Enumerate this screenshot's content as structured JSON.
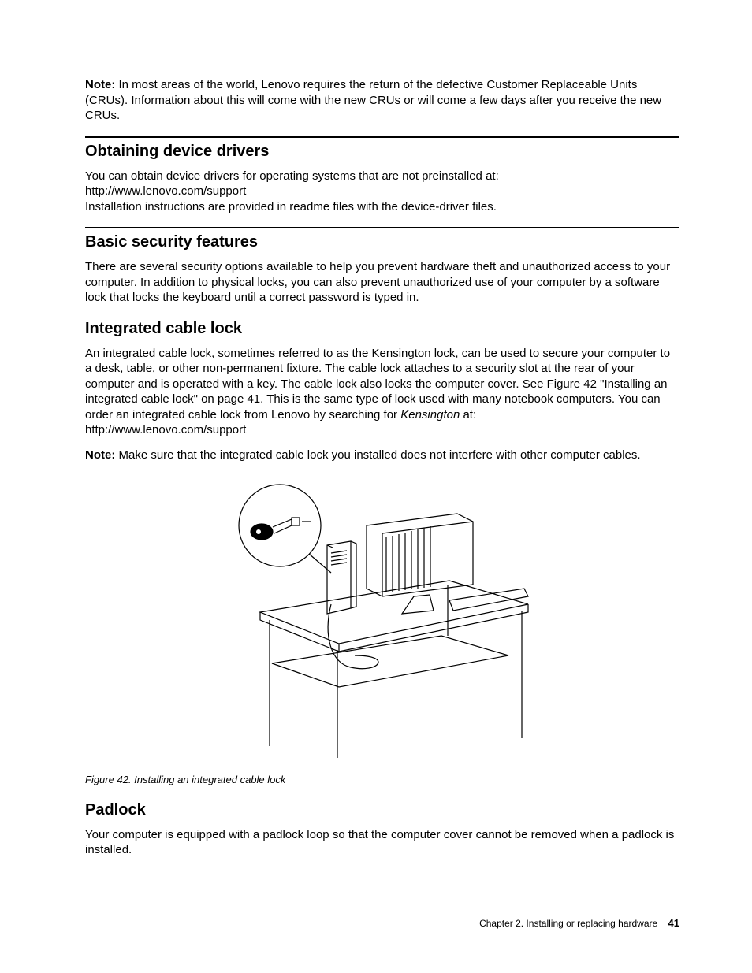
{
  "note1": {
    "label": "Note:",
    "text": " In most areas of the world, Lenovo requires the return of the defective Customer Replaceable Units (CRUs). Information about this will come with the new CRUs or will come a few days after you receive the new CRUs."
  },
  "sec_drivers": {
    "heading": "Obtaining device drivers",
    "p1": "You can obtain device drivers for operating systems that are not preinstalled at:",
    "url": "http://www.lenovo.com/support",
    "p2": "Installation instructions are provided in readme files with the device-driver files."
  },
  "sec_security": {
    "heading": "Basic security features",
    "p1": "There are several security options available to help you prevent hardware theft and unauthorized access to your computer. In addition to physical locks, you can also prevent unauthorized use of your computer by a software lock that locks the keyboard until a correct password is typed in."
  },
  "sec_cablelock": {
    "heading": "Integrated cable lock",
    "p1_a": "An integrated cable lock, sometimes referred to as the Kensington lock, can be used to secure your computer to a desk, table, or other non-permanent fixture. The cable lock attaches to a security slot at the rear of your computer and is operated with a key. The cable lock also locks the computer cover. See Figure 42 \"Installing an integrated cable lock\" on page 41. This is the same type of lock used with many notebook computers. You can order an integrated cable lock from Lenovo by searching for ",
    "p1_italic": "Kensington",
    "p1_b": " at:",
    "url": "http://www.lenovo.com/support",
    "note_label": "Note:",
    "note_text": " Make sure that the integrated cable lock you installed does not interfere with other computer cables."
  },
  "figure": {
    "caption": "Figure 42.  Installing an integrated cable lock"
  },
  "sec_padlock": {
    "heading": "Padlock",
    "p1": "Your computer is equipped with a padlock loop so that the computer cover cannot be removed when a padlock is installed."
  },
  "footer": {
    "chapter": "Chapter 2.  Installing or replacing hardware",
    "pagenum": "41"
  }
}
